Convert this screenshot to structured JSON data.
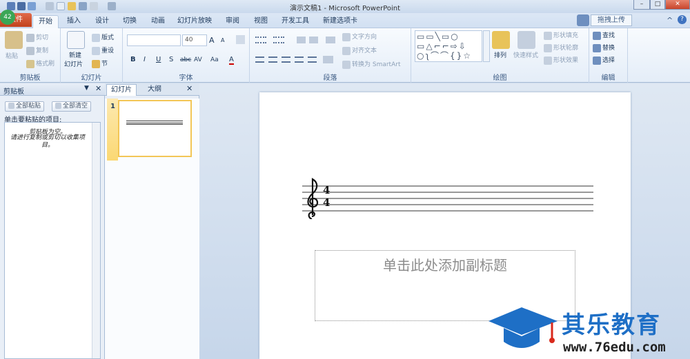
{
  "window": {
    "title": "演示文稿1 - Microsoft PowerPoint",
    "badge": "42"
  },
  "tabs": [
    {
      "label": "文件"
    },
    {
      "label": "开始"
    },
    {
      "label": "插入"
    },
    {
      "label": "设计"
    },
    {
      "label": "切换"
    },
    {
      "label": "动画"
    },
    {
      "label": "幻灯片放映"
    },
    {
      "label": "审阅"
    },
    {
      "label": "视图"
    },
    {
      "label": "开发工具"
    },
    {
      "label": "新建选项卡"
    }
  ],
  "upload_button": "拖拽上传",
  "ribbon": {
    "clipboard": {
      "label": "剪贴板",
      "paste": "粘贴",
      "cut": "剪切",
      "copy": "复制",
      "format_painter": "格式刷"
    },
    "slides": {
      "label": "幻灯片",
      "new_slide": "新建",
      "new_slide2": "幻灯片",
      "layout": "版式",
      "reset": "重设",
      "section": "节"
    },
    "font": {
      "label": "字体",
      "size": "40",
      "grow": "A",
      "shrink": "A",
      "bold": "B",
      "italic": "I",
      "underline": "U",
      "shadow": "S",
      "strike": "abc",
      "spacing": "AV",
      "case": "Aa",
      "color": "A"
    },
    "paragraph": {
      "label": "段落",
      "text_direction": "文字方向",
      "align_text": "对齐文本",
      "smartart": "转换为 SmartArt"
    },
    "drawing": {
      "label": "绘图",
      "arrange": "排列",
      "quick_styles": "快速样式",
      "shape_fill": "形状填充",
      "shape_outline": "形状轮廓",
      "shape_effects": "形状效果"
    },
    "editing": {
      "label": "编辑",
      "find": "查找",
      "replace": "替换",
      "select": "选择"
    }
  },
  "clipboard_pane": {
    "title": "剪贴板",
    "paste_all": "全部粘贴",
    "clear_all": "全部清空",
    "prompt": "单击要粘贴的项目:",
    "empty_line1": "剪贴板为空。",
    "empty_line2": "请进行复制或剪切以收集项目。"
  },
  "slides_pane": {
    "tab_slides": "幻灯片",
    "tab_outline": "大纲",
    "slide_number": "1"
  },
  "slide": {
    "time_top": "4",
    "time_bottom": "4",
    "subtitle_placeholder": "单击此处添加副标题"
  },
  "watermark": {
    "name": "其乐教育",
    "url": "www.76edu.com"
  },
  "colors": {
    "file_tab": "#c2421c",
    "accent": "#1e395b",
    "watermark_blue": "#1e6fc6",
    "watermark_red": "#d92a1c"
  }
}
